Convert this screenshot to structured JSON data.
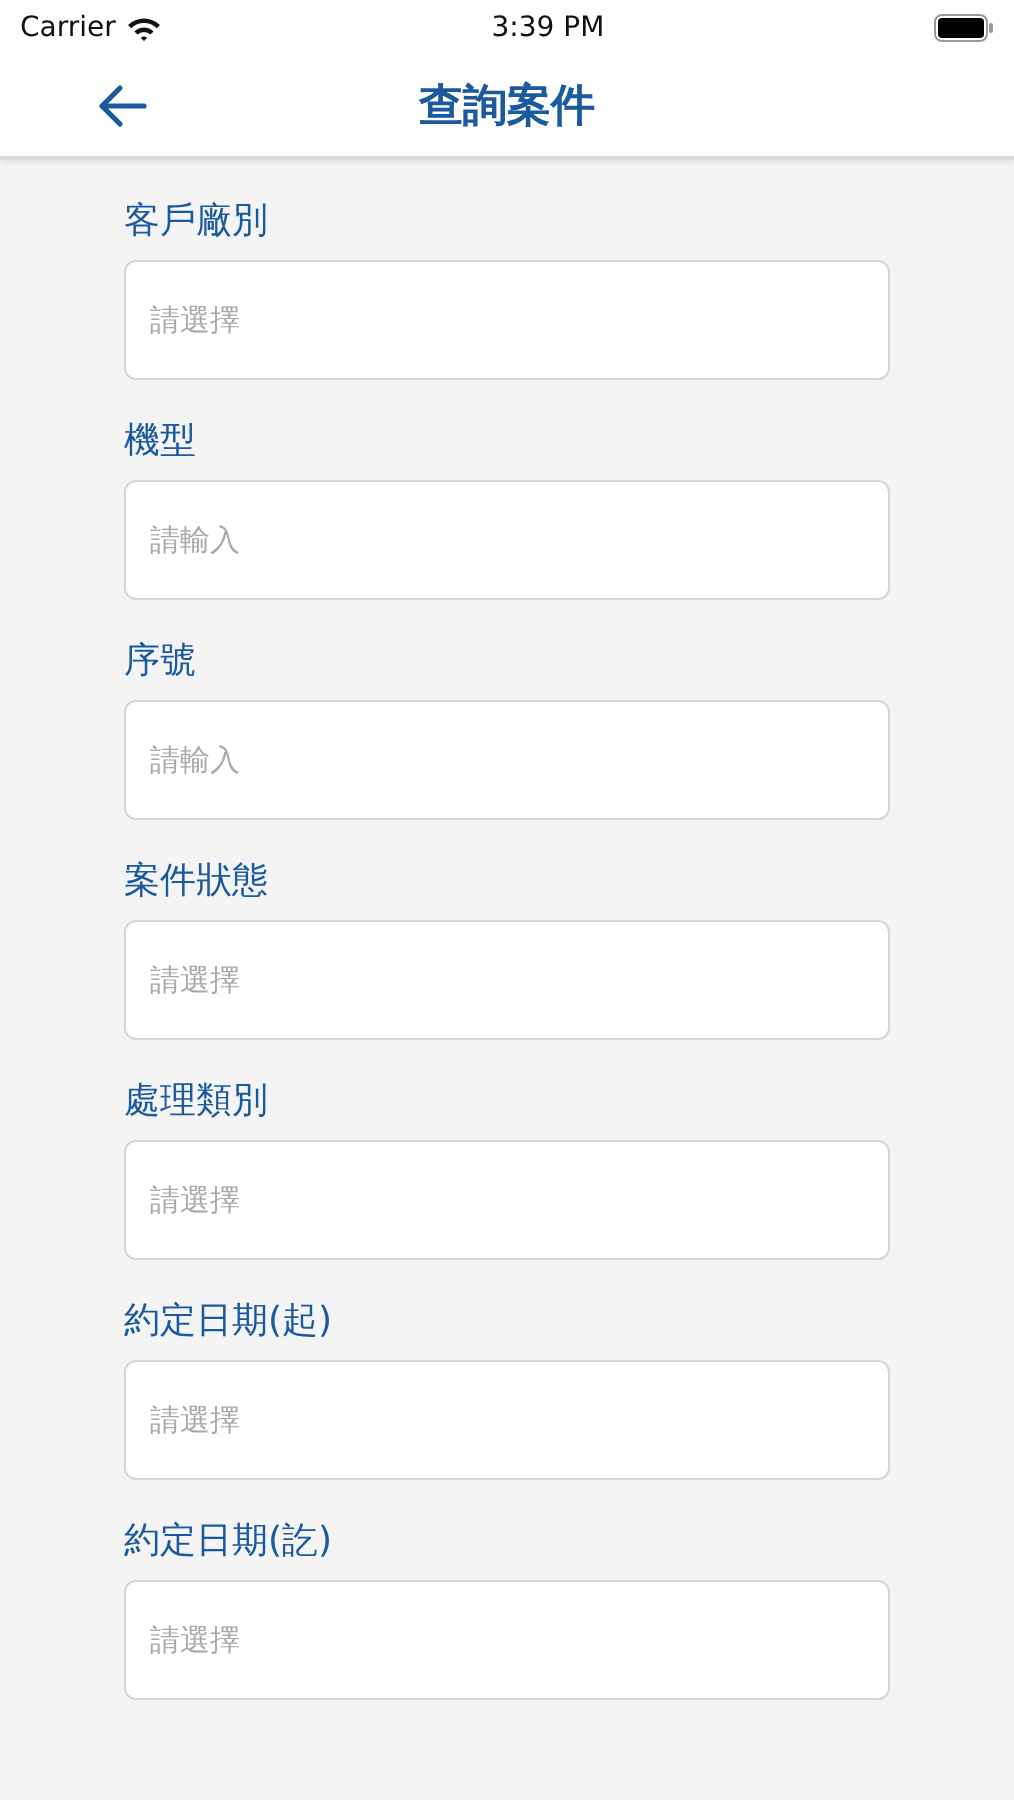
{
  "status_bar": {
    "carrier": "Carrier",
    "time": "3:39 PM"
  },
  "nav_bar": {
    "title": "查詢案件"
  },
  "fields": [
    {
      "label": "客戶廠別",
      "placeholder": "請選擇"
    },
    {
      "label": "機型",
      "placeholder": "請輸入"
    },
    {
      "label": "序號",
      "placeholder": "請輸入"
    },
    {
      "label": "案件狀態",
      "placeholder": "請選擇"
    },
    {
      "label": "處理類別",
      "placeholder": "請選擇"
    },
    {
      "label": "約定日期(起)",
      "placeholder": "請選擇"
    },
    {
      "label": "約定日期(訖)",
      "placeholder": "請選擇"
    }
  ]
}
